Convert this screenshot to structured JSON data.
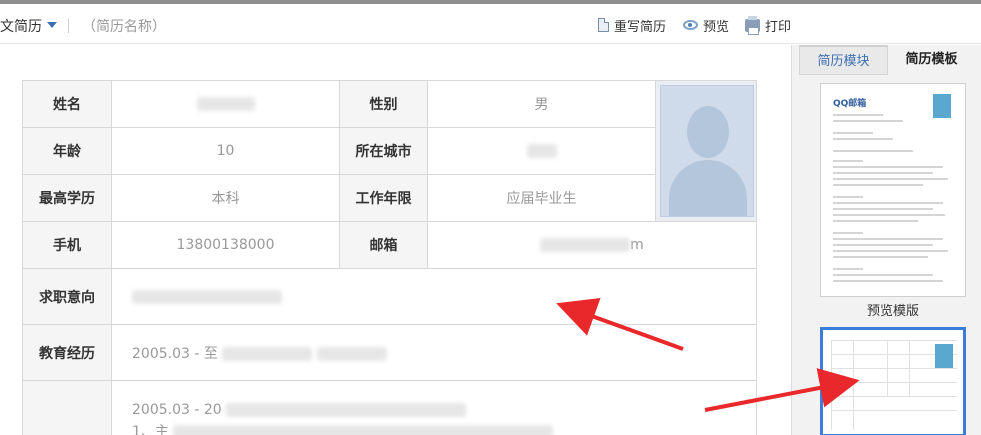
{
  "toolbar": {
    "title": "文简历",
    "resume_name_placeholder": "（简历名称）",
    "rewrite_label": "重写简历",
    "preview_label": "预览",
    "print_label": "打印"
  },
  "resume": {
    "name_label": "姓名",
    "gender_label": "性别",
    "gender_value": "男",
    "age_label": "年龄",
    "age_value": "10",
    "city_label": "所在城市",
    "education_label": "最高学历",
    "education_value": "本科",
    "work_years_label": "工作年限",
    "work_years_value": "应届毕业生",
    "phone_label": "手机",
    "phone_value": "13800138000",
    "email_label": "邮箱",
    "email_partial": "m",
    "job_intent_label": "求职意向",
    "edu_history_label": "教育经历",
    "edu_history_date": "2005.03 - 至",
    "exp_date": "2005.03 - 20",
    "exp_item_prefix": "1、主"
  },
  "right_panel": {
    "tab_modules": "简历模块",
    "tab_templates": "简历模板",
    "template1_name": "QQ邮箱",
    "preview_template_label": "预览模版"
  },
  "colors": {
    "accent_blue": "#3d6fb5",
    "arrow_red": "#e8282a",
    "selected_border": "#3b7dd8"
  }
}
